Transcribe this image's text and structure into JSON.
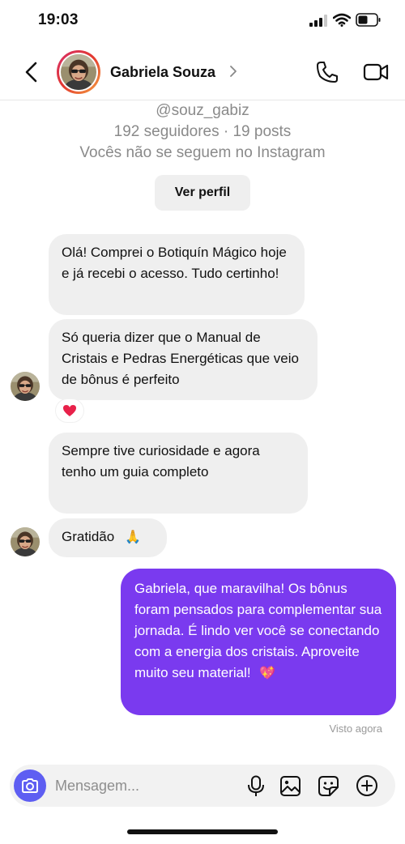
{
  "status_bar": {
    "time": "19:03",
    "icons": [
      "cellular-signal-icon",
      "wifi-icon",
      "battery-icon"
    ]
  },
  "header": {
    "back_icon": "chevron-left-icon",
    "contact_name": "Gabriela Souza",
    "name_chevron_icon": "chevron-right-icon",
    "call_icon": "phone-icon",
    "video_icon": "video-camera-icon"
  },
  "profile": {
    "handle": "@souz_gabiz",
    "stats": "192 seguidores · 19 posts",
    "follow_status": "Vocês não se seguem no Instagram",
    "view_profile_label": "Ver perfil"
  },
  "messages": [
    {
      "from": "contact",
      "text": "Olá! Comprei o Botiquín Mágico hoje e já recebi o acesso. Tudo certinho!"
    },
    {
      "from": "contact",
      "text": "Só queria dizer que o Manual de Cristais e Pedras Energéticas que veio de bônus é perfeito",
      "reaction": "❤️"
    },
    {
      "from": "contact",
      "text": "Sempre tive curiosidade e agora tenho um guia completo"
    },
    {
      "from": "contact",
      "text": "Gratidão",
      "emoji": "🙏"
    },
    {
      "from": "me",
      "text": "Gabriela, que maravilha! Os bônus foram pensados para complementar sua jornada. É lindo ver você se conectando com a energia dos cristais. Aproveite muito seu material!",
      "emoji": "💖"
    }
  ],
  "seen_label": "Visto agora",
  "composer": {
    "placeholder": "Mensagem...",
    "icons": [
      "camera-icon",
      "microphone-icon",
      "image-gallery-icon",
      "sticker-icon",
      "plus-circle-icon"
    ]
  },
  "colors": {
    "outgoing_bubble": "#7a3aef",
    "incoming_bubble": "#efefef",
    "camera_button": "#5e5ef2",
    "secondary_text": "#8a8a8a"
  }
}
